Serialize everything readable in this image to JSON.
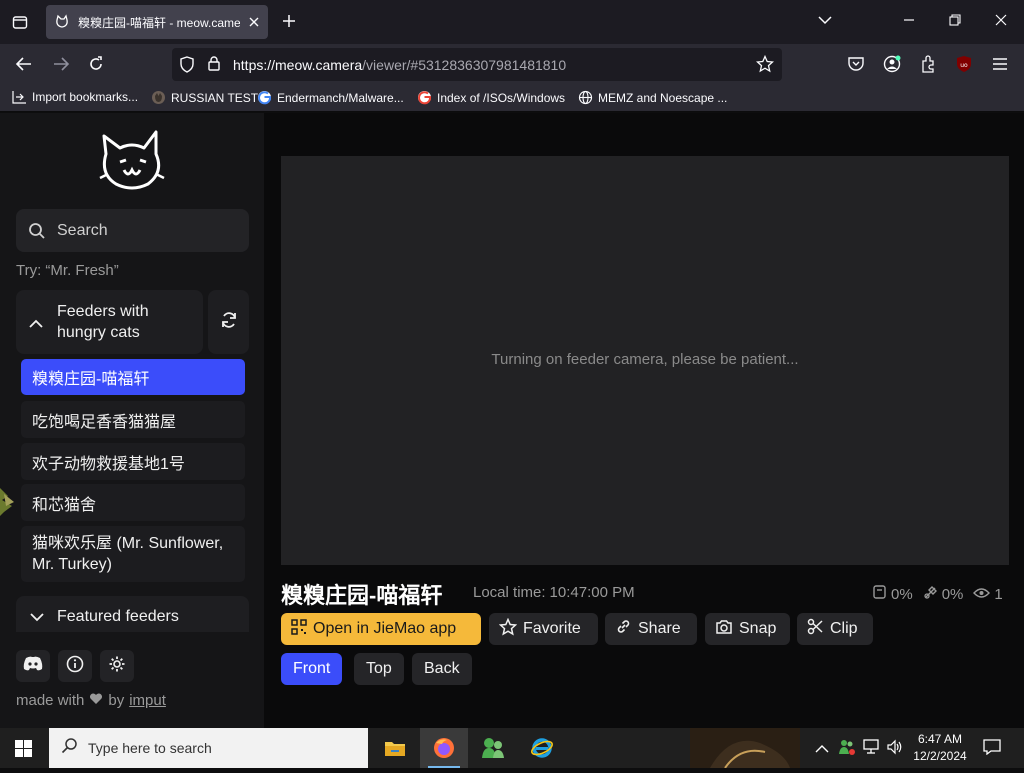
{
  "browser": {
    "tab_title": "糗糗庄园-喵福轩 - meow.camera",
    "url_host": "https://meow.camera",
    "url_path": "/viewer/#5312836307981481810",
    "bookmarks": [
      "Import bookmarks...",
      "RUSSIAN TEST",
      "Endermanch/Malware...",
      "Index of /ISOs/Windows",
      "MEMZ and Noescape ..."
    ],
    "icons": [
      "list-all-tabs-icon",
      "tab-favicon-cat-icon",
      "close-tab-icon",
      "new-tab-icon",
      "tab-list-chevron-icon",
      "minimize-icon",
      "restore-icon",
      "close-window-icon",
      "back-icon",
      "forward-icon",
      "reload-icon",
      "shield-icon",
      "lock-icon",
      "star-icon",
      "pocket-icon",
      "account-icon",
      "extensions-icon",
      "ublock-icon",
      "menu-icon"
    ]
  },
  "sidebar": {
    "search_placeholder": "Search",
    "hint": "Try: “Mr. Fresh”",
    "group_title": "Feeders with hungry cats",
    "items": [
      {
        "label": "糗糗庄园-喵福轩",
        "active": true
      },
      {
        "label": "吃饱喝足香香猫猫屋",
        "active": false
      },
      {
        "label": "欢子动物救援基地1号",
        "active": false
      },
      {
        "label": "和芯猫舍",
        "active": false
      },
      {
        "label": "猫咪欢乐屋 (Mr. Sunflower, Mr. Turkey)",
        "active": false
      }
    ],
    "featured_title": "Featured feeders",
    "footer_made": "made with",
    "footer_by": "by",
    "footer_link": "imput"
  },
  "viewer": {
    "status": "Turning on feeder camera, please be patient...",
    "title": "糗糗庄园-喵福轩",
    "local_time_label": "Local time:",
    "local_time": "10:47:00 PM",
    "stat_food": "0%",
    "stat_battery": "0%",
    "stat_viewers": "1",
    "buttons": {
      "open_app": "Open in JieMao app",
      "favorite": "Favorite",
      "share": "Share",
      "snap": "Snap",
      "clip": "Clip"
    },
    "camera_tabs": [
      {
        "label": "Front",
        "active": true
      },
      {
        "label": "Top",
        "active": false
      },
      {
        "label": "Back",
        "active": false
      }
    ]
  },
  "taskbar": {
    "search_placeholder": "Type here to search",
    "time": "6:47 AM",
    "date": "12/2/2024"
  },
  "colors": {
    "accent": "#3b4dfa",
    "yellow": "#f5b93a"
  }
}
